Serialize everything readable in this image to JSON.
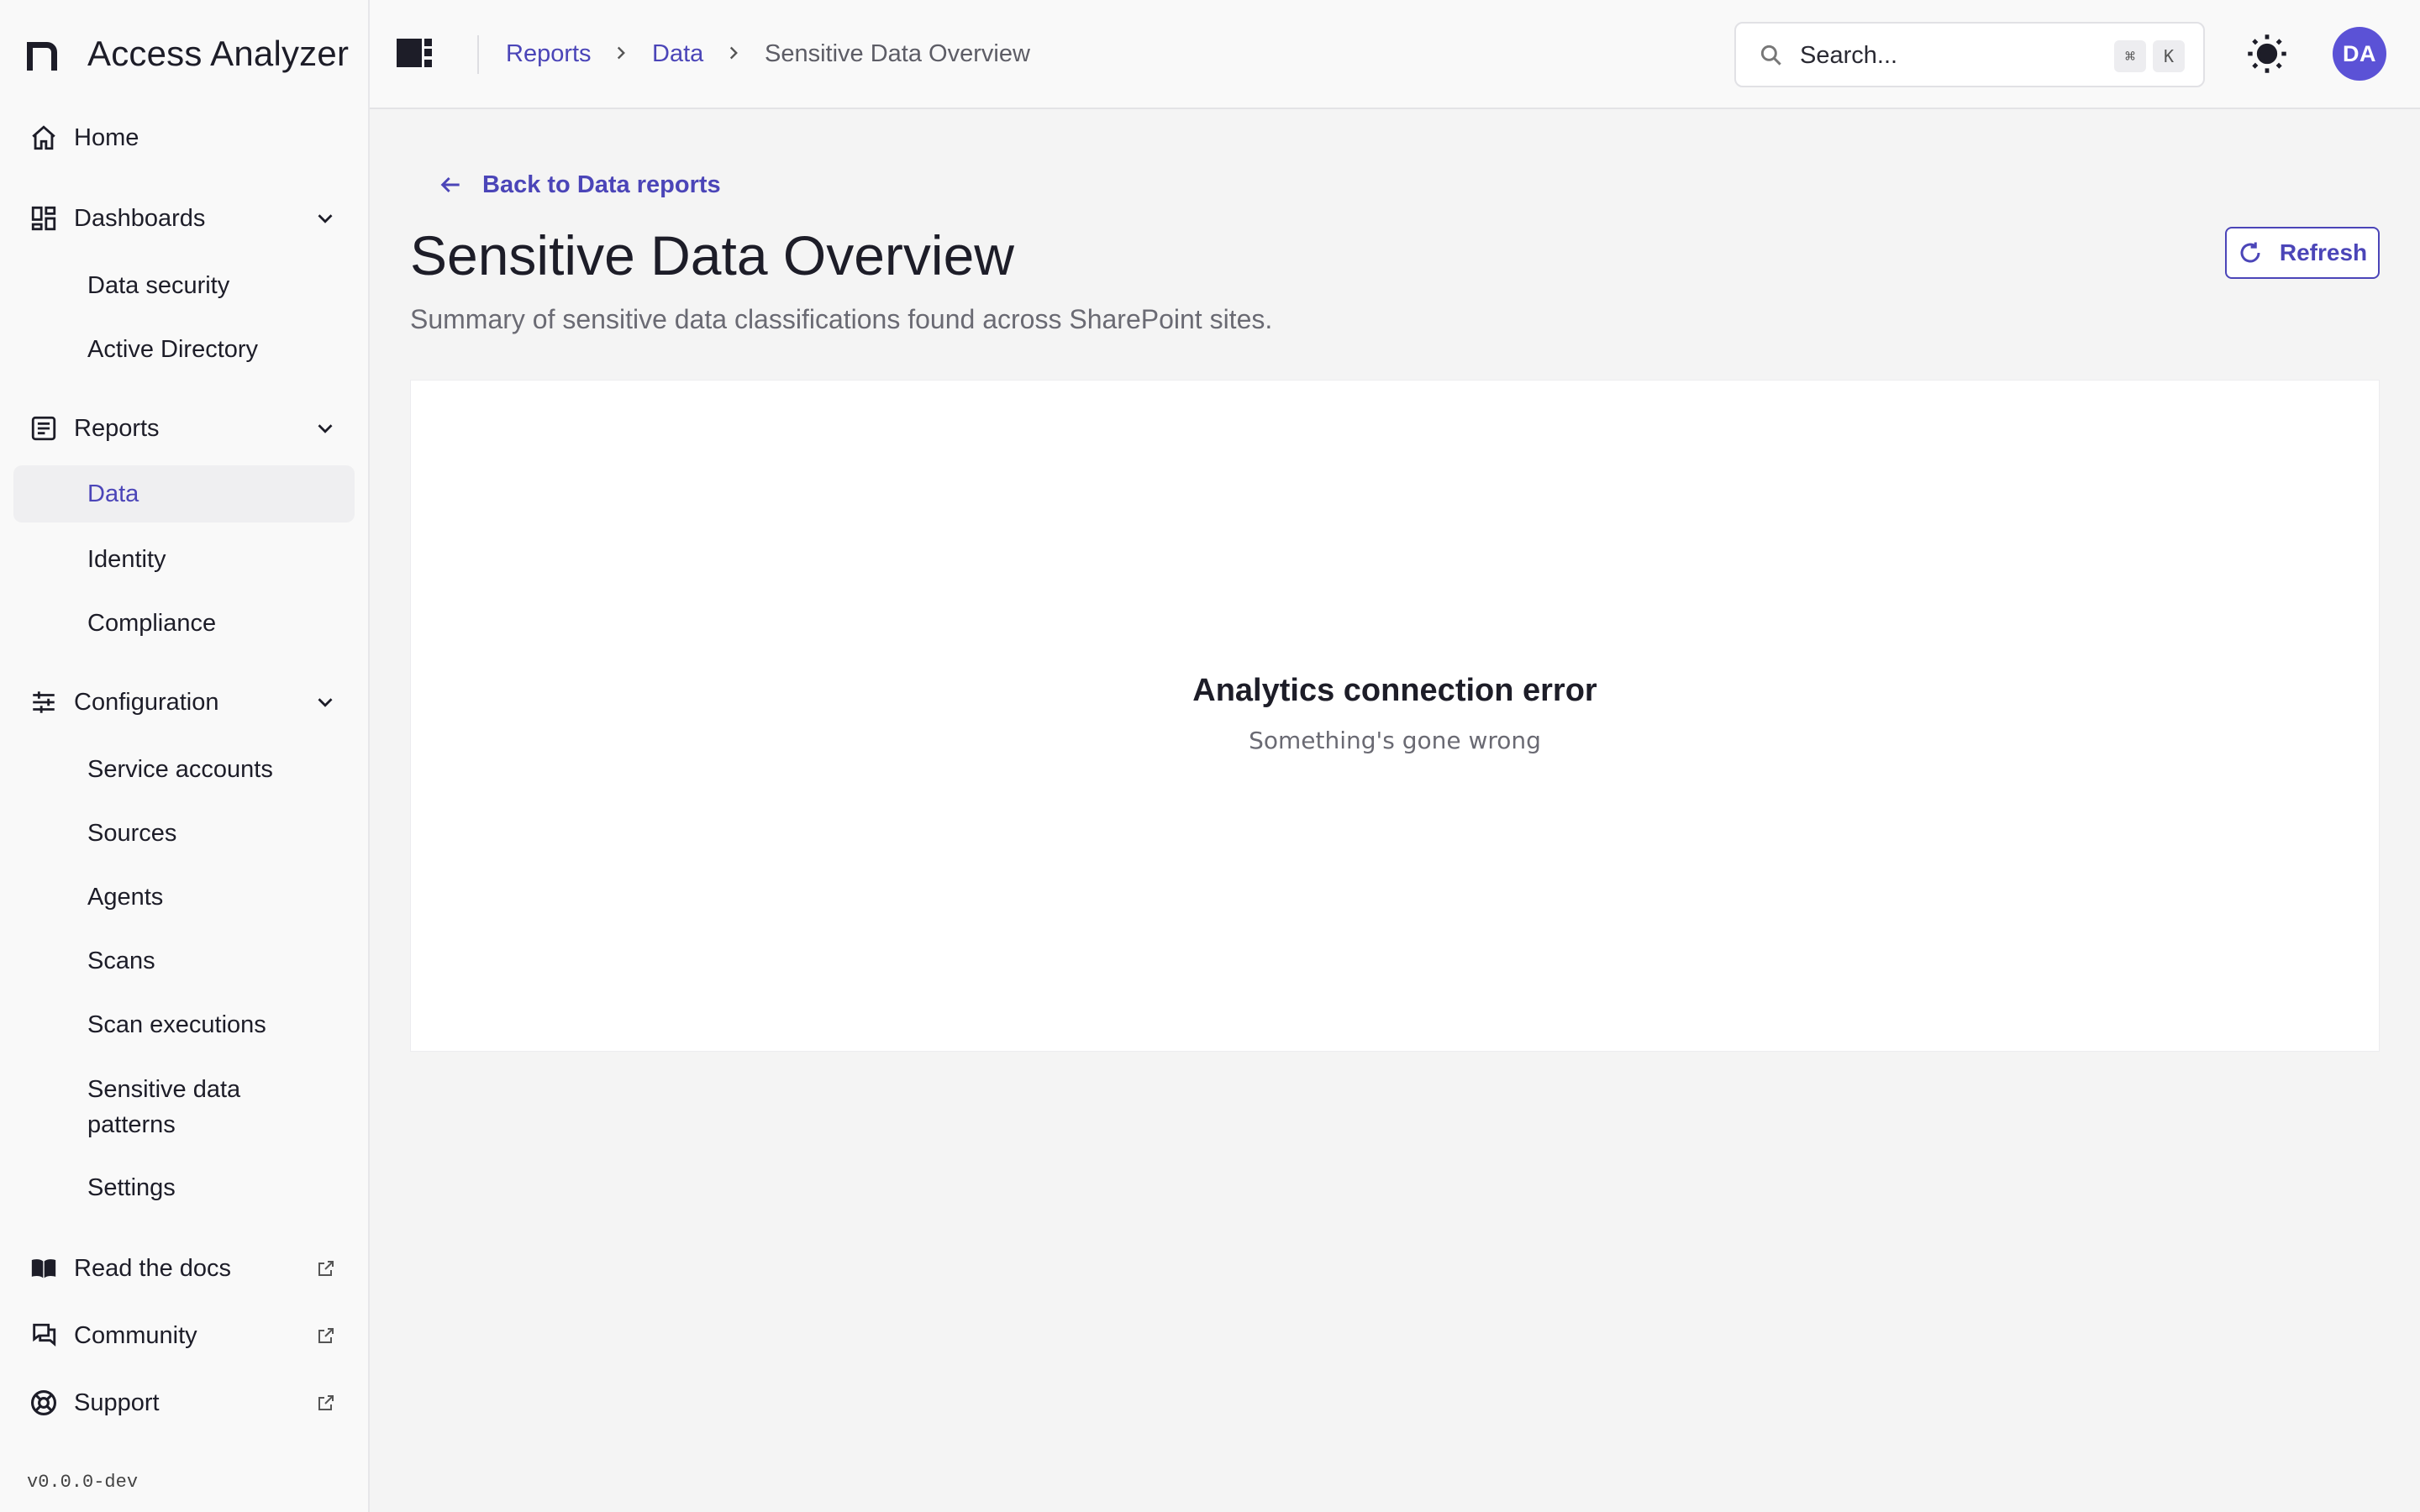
{
  "app": {
    "name": "Access Analyzer",
    "version": "v0.0.0-dev"
  },
  "sidebar": {
    "home": "Home",
    "dashboards": {
      "label": "Dashboards",
      "items": [
        "Data security",
        "Active Directory"
      ]
    },
    "reports": {
      "label": "Reports",
      "items": [
        "Data",
        "Identity",
        "Compliance"
      ],
      "active": "Data"
    },
    "configuration": {
      "label": "Configuration",
      "items": [
        "Service accounts",
        "Sources",
        "Agents",
        "Scans",
        "Scan executions",
        "Sensitive data patterns",
        "Settings"
      ]
    },
    "links": [
      "Read the docs",
      "Community",
      "Support"
    ]
  },
  "topbar": {
    "breadcrumb": [
      "Reports",
      "Data",
      "Sensitive Data Overview"
    ],
    "search_placeholder": "Search...",
    "shortcut_keys": [
      "⌘",
      "K"
    ],
    "avatar_initials": "DA"
  },
  "main": {
    "back_link": "Back to Data reports",
    "title": "Sensitive Data Overview",
    "subtitle": "Summary of sensitive data classifications found across SharePoint sites.",
    "refresh_label": "Refresh",
    "error": {
      "title": "Analytics connection error",
      "message": "Something's gone wrong"
    }
  },
  "colors": {
    "accent": "#4b45b8",
    "avatar": "#5b52d6",
    "background": "#f4f4f4",
    "sidebar": "#f9f9f9"
  }
}
